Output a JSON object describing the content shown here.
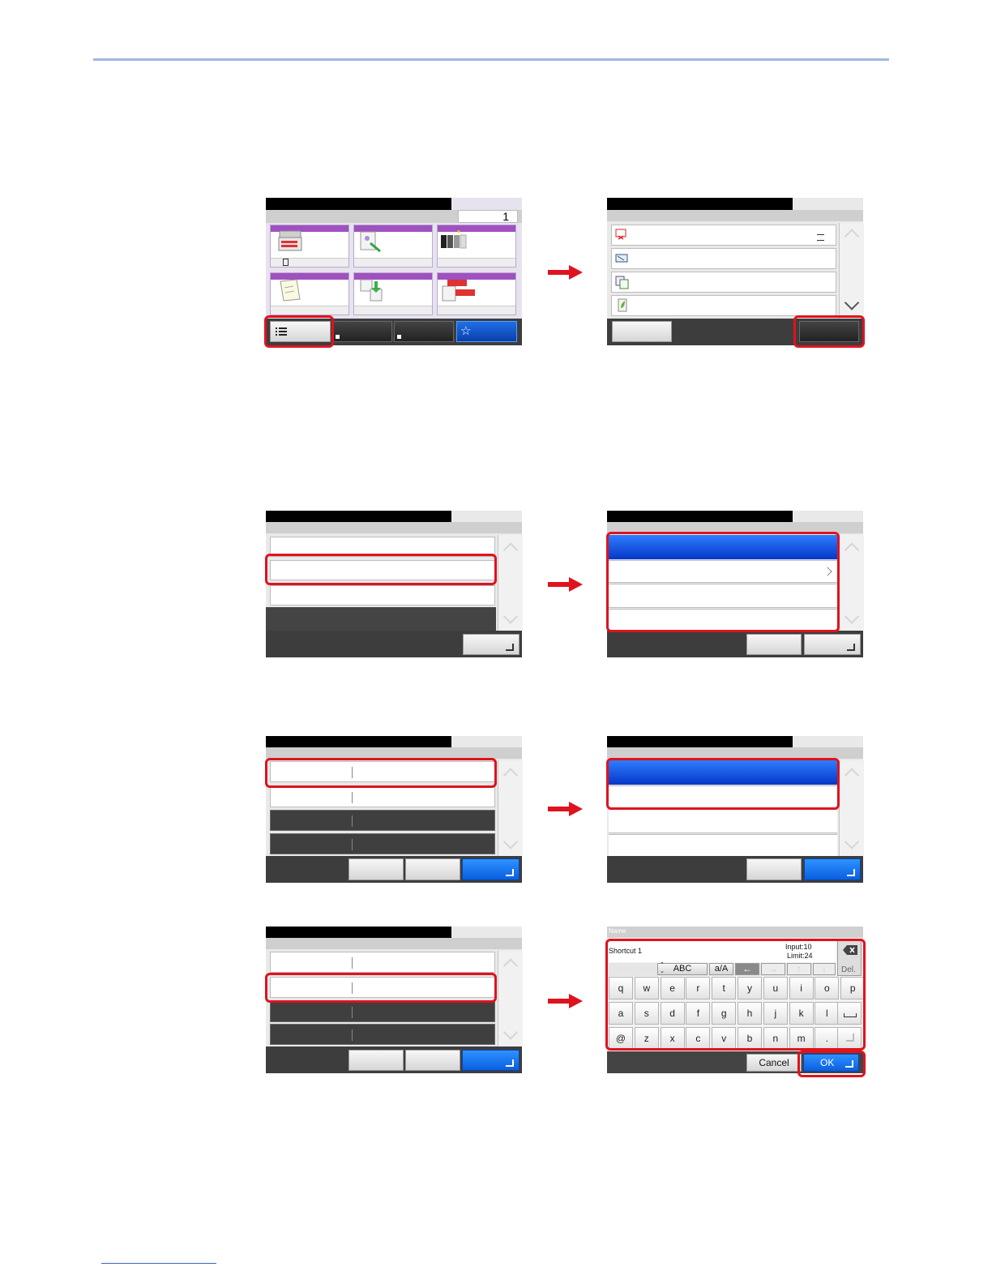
{
  "home_screen": {
    "page_number": "1"
  },
  "keyboard_screen": {
    "title": "Name",
    "input_value": "Shortcut 1",
    "input_count": "Input:10",
    "input_limit": "Limit:24",
    "del_label": "Del.",
    "mode_label": "ABC",
    "case_label": "a/A",
    "row1": [
      "q",
      "w",
      "e",
      "r",
      "t",
      "y",
      "u",
      "i",
      "o",
      "p"
    ],
    "row2": [
      "a",
      "s",
      "d",
      "f",
      "g",
      "h",
      "j",
      "k",
      "l"
    ],
    "row3": [
      "@",
      "z",
      "x",
      "c",
      "v",
      "b",
      "n",
      "m",
      "."
    ],
    "cancel_label": "Cancel",
    "ok_label": "OK"
  },
  "colors": {
    "highlight": "#e0121e",
    "selected_row": "#0a4fe0",
    "tile_band": "#a050c0",
    "rule": "#9fb8e0"
  }
}
